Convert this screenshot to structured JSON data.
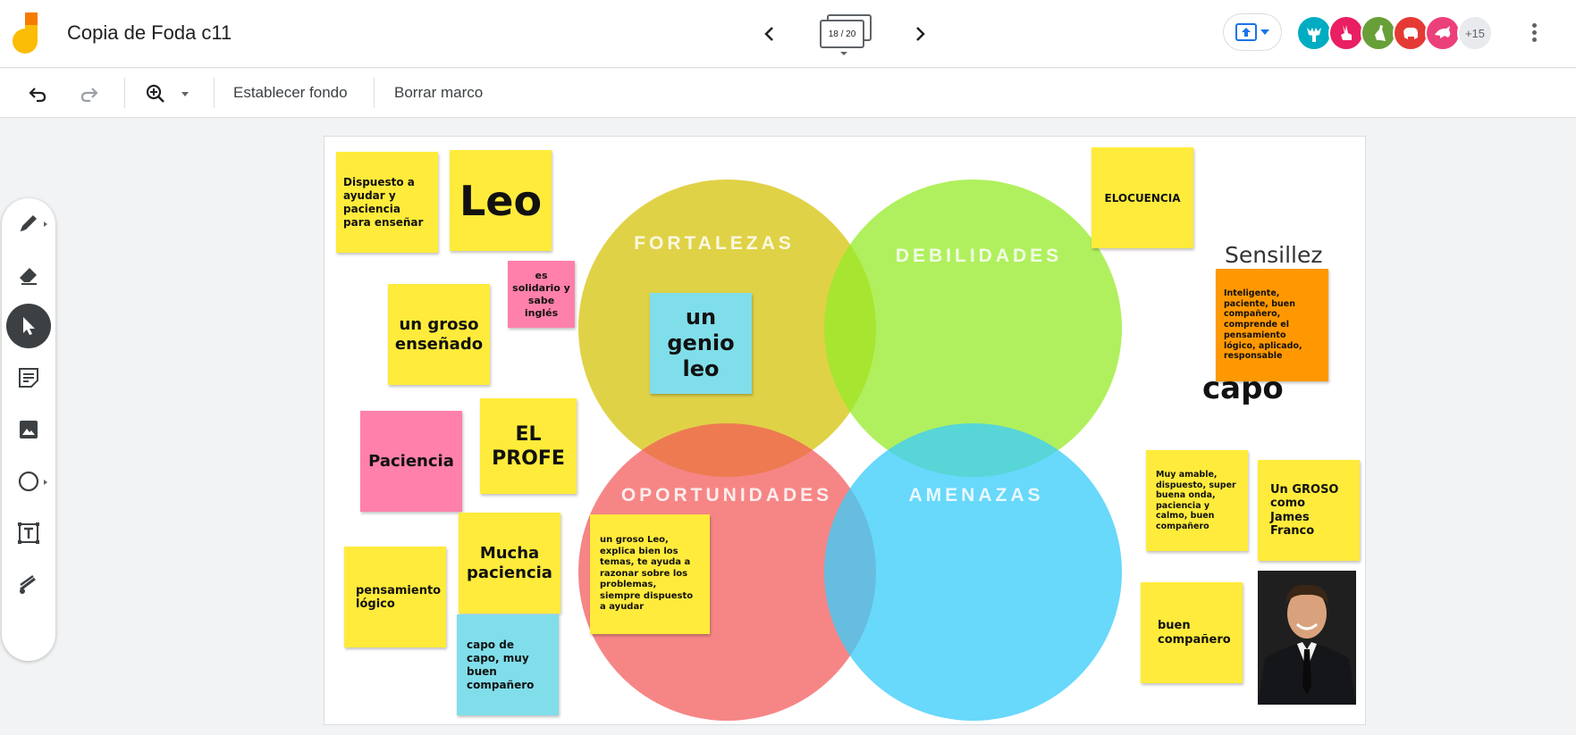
{
  "header": {
    "title": "Copia de Foda c11",
    "frame_counter": "18 / 20",
    "collaborators_more": "+15"
  },
  "colors": {
    "accent": "#1a73e8",
    "fortalezas": "#d4c000",
    "debilidades": "#a0ea3c",
    "oportunidades": "#f56565",
    "amenazas": "#4dcffa"
  },
  "avatars": [
    {
      "icon": "moose-icon",
      "color": "#00acc1"
    },
    {
      "icon": "rabbit-icon",
      "color": "#e91e63"
    },
    {
      "icon": "kangaroo-icon",
      "color": "#689f38"
    },
    {
      "icon": "pig-icon",
      "color": "#e53935"
    },
    {
      "icon": "dolphin-icon",
      "color": "#ec407a"
    }
  ],
  "toolbar": {
    "set_background": "Establecer fondo",
    "clear_frame": "Borrar marco"
  },
  "tools": [
    "pen-icon",
    "eraser-icon",
    "select-icon",
    "sticky-note-icon",
    "image-icon",
    "circle-shape-icon",
    "text-box-icon",
    "laser-icon"
  ],
  "board": {
    "circles": {
      "fortalezas": "FORTALEZAS",
      "debilidades": "DEBILIDADES",
      "oportunidades": "OPORTUNIDADES",
      "amenazas": "AMENAZAS"
    },
    "notes": {
      "dispuesto": "Dispuesto a ayudar y paciencia para enseñar",
      "leo": "Leo",
      "solidario": "es solidario y sabe inglés",
      "groso": "un groso enseñado",
      "genio": "un genio leo",
      "paciencia": "Paciencia",
      "profe": "EL PROFE",
      "mucha": "Mucha paciencia",
      "pensamiento": "pensamiento lógico",
      "capo_capo": "capo de capo, muy buen compañero",
      "groso_leo": "un groso Leo, explica bien los temas, te ayuda a razonar sobre los problemas, siempre dispuesto a ayudar",
      "elocuencia": "ELOCUENCIA",
      "inteligente": "Inteligente, paciente, buen compañero, comprende el pensamiento lógico, aplicado, responsable",
      "amable": "Muy amable, dispuesto, super buena onda, paciencia y calmo, buen compañero",
      "james": "Un GROSO como James Franco",
      "buen": "buen compañero"
    },
    "texts": {
      "sensillez": "Sensillez",
      "capo": "capo"
    }
  }
}
